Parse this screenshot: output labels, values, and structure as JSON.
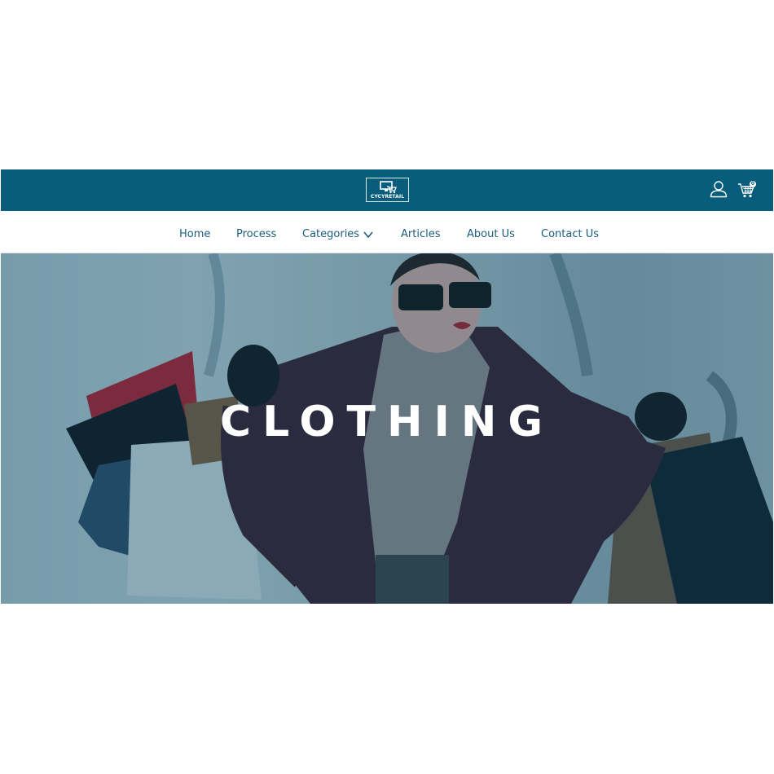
{
  "header": {
    "logo_text": "CYCYRETAIL",
    "cart_count": "0",
    "colors": {
      "bar": "#085c7c",
      "icon": "#ffffff"
    }
  },
  "nav": {
    "items": [
      {
        "label": "Home"
      },
      {
        "label": "Process"
      },
      {
        "label": "Categories"
      },
      {
        "label": "Articles"
      },
      {
        "label": "About Us"
      },
      {
        "label": "Contact Us"
      }
    ],
    "text_color": "#1b5c7e"
  },
  "hero": {
    "title": "CLOTHING",
    "overlay_color": "#0b4a66"
  },
  "icons": {
    "logo": "shopping-cart-computer-icon",
    "user": "user-icon",
    "cart": "shopping-cart-icon",
    "dropdown": "chevron-down-icon"
  }
}
